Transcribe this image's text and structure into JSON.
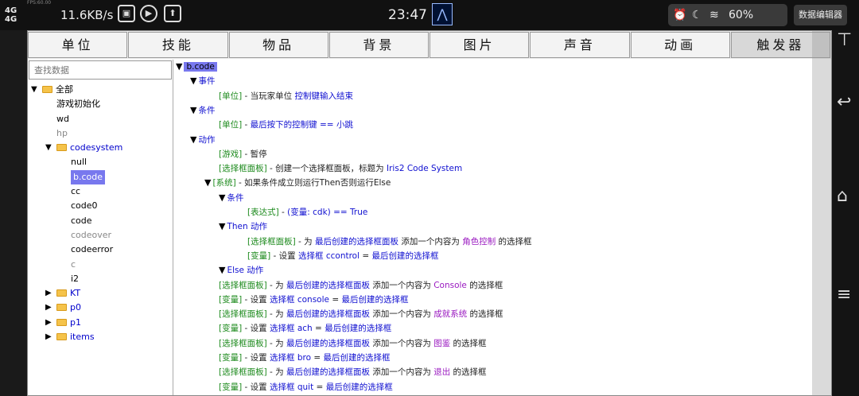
{
  "status_bar": {
    "signal": "4G",
    "tiny_label": "FPS:60.00",
    "speed": "11.6KB/s",
    "clock": "23:47",
    "battery": "60%",
    "mode_button": "数据编辑器"
  },
  "tabs": [
    "单位",
    "技能",
    "物品",
    "背景",
    "图片",
    "声音",
    "动画",
    "触发器"
  ],
  "search": {
    "placeholder": "查找数据"
  },
  "tree": [
    {
      "label": "全部",
      "indent": 0,
      "arrow": "▼",
      "folder": true,
      "style": ""
    },
    {
      "label": "游戏初始化",
      "indent": 1,
      "arrow": "",
      "folder": false,
      "style": ""
    },
    {
      "label": "wd",
      "indent": 1,
      "arrow": "",
      "folder": false,
      "style": ""
    },
    {
      "label": "hp",
      "indent": 1,
      "arrow": "",
      "folder": false,
      "style": "gray"
    },
    {
      "label": "codesystem",
      "indent": 1,
      "arrow": "▼",
      "folder": true,
      "style": "blue"
    },
    {
      "label": "null",
      "indent": 2,
      "arrow": "",
      "folder": false,
      "style": ""
    },
    {
      "label": "b.code",
      "indent": 2,
      "arrow": "",
      "folder": false,
      "style": "sel"
    },
    {
      "label": "cc",
      "indent": 2,
      "arrow": "",
      "folder": false,
      "style": ""
    },
    {
      "label": "code0",
      "indent": 2,
      "arrow": "",
      "folder": false,
      "style": ""
    },
    {
      "label": "code",
      "indent": 2,
      "arrow": "",
      "folder": false,
      "style": ""
    },
    {
      "label": "codeover",
      "indent": 2,
      "arrow": "",
      "folder": false,
      "style": "gray"
    },
    {
      "label": "codeerror",
      "indent": 2,
      "arrow": "",
      "folder": false,
      "style": ""
    },
    {
      "label": "c",
      "indent": 2,
      "arrow": "",
      "folder": false,
      "style": "gray"
    },
    {
      "label": "i2",
      "indent": 2,
      "arrow": "",
      "folder": false,
      "style": ""
    },
    {
      "label": "KT",
      "indent": 1,
      "arrow": "▶",
      "folder": true,
      "style": "blue"
    },
    {
      "label": "p0",
      "indent": 1,
      "arrow": "▶",
      "folder": true,
      "style": "blue"
    },
    {
      "label": "p1",
      "indent": 1,
      "arrow": "▶",
      "folder": true,
      "style": "blue"
    },
    {
      "label": "items",
      "indent": 1,
      "arrow": "▶",
      "folder": true,
      "style": "blue"
    }
  ],
  "code_lines": [
    {
      "indent": 0,
      "arrow": "▼",
      "parts": [
        {
          "t": "b.code",
          "c": "selhead"
        }
      ]
    },
    {
      "indent": 1,
      "arrow": "▼",
      "parts": [
        {
          "t": "事件",
          "c": "t-blue"
        }
      ]
    },
    {
      "indent": 2,
      "arrow": "",
      "parts": [
        {
          "t": "[单位]",
          "c": "t-green"
        },
        {
          "t": " - 当玩家单位 ",
          "c": "t-black"
        },
        {
          "t": "控制键输入结束",
          "c": "t-blue"
        }
      ]
    },
    {
      "indent": 1,
      "arrow": "▼",
      "parts": [
        {
          "t": "条件",
          "c": "t-blue"
        }
      ]
    },
    {
      "indent": 2,
      "arrow": "",
      "parts": [
        {
          "t": "[单位]",
          "c": "t-green"
        },
        {
          "t": " - ",
          "c": "t-black"
        },
        {
          "t": "最后按下的控制键 == 小跳",
          "c": "t-blue"
        }
      ]
    },
    {
      "indent": 1,
      "arrow": "▼",
      "parts": [
        {
          "t": "动作",
          "c": "t-blue"
        }
      ]
    },
    {
      "indent": 2,
      "arrow": "",
      "parts": [
        {
          "t": "[游戏]",
          "c": "t-green"
        },
        {
          "t": " - 暂停",
          "c": "t-black"
        }
      ]
    },
    {
      "indent": 2,
      "arrow": "",
      "parts": [
        {
          "t": "[选择框面板]",
          "c": "t-green"
        },
        {
          "t": " - 创建一个选择框面板，标题为 ",
          "c": "t-black"
        },
        {
          "t": "Iris2 Code System",
          "c": "t-blue"
        }
      ]
    },
    {
      "indent": 2,
      "arrow": "▼",
      "parts": [
        {
          "t": "[系统]",
          "c": "t-green"
        },
        {
          "t": " - 如果条件成立则运行Then否则运行Else",
          "c": "t-black"
        }
      ]
    },
    {
      "indent": 3,
      "arrow": "▼",
      "parts": [
        {
          "t": "条件",
          "c": "t-blue"
        }
      ]
    },
    {
      "indent": 4,
      "arrow": "",
      "parts": [
        {
          "t": "[表达式]",
          "c": "t-green"
        },
        {
          "t": " - ",
          "c": "t-black"
        },
        {
          "t": "(变量: cdk) == True",
          "c": "t-blue"
        }
      ]
    },
    {
      "indent": 3,
      "arrow": "▼",
      "parts": [
        {
          "t": "Then 动作",
          "c": "t-blue"
        }
      ]
    },
    {
      "indent": 4,
      "arrow": "",
      "parts": [
        {
          "t": "[选择框面板]",
          "c": "t-green"
        },
        {
          "t": " - 为 ",
          "c": "t-black"
        },
        {
          "t": "最后创建的选择框面板",
          "c": "t-blue"
        },
        {
          "t": " 添加一个内容为 ",
          "c": "t-black"
        },
        {
          "t": "角色控制",
          "c": "t-purple"
        },
        {
          "t": " 的选择框",
          "c": "t-black"
        }
      ]
    },
    {
      "indent": 4,
      "arrow": "",
      "parts": [
        {
          "t": "[变量]",
          "c": "t-green"
        },
        {
          "t": " - 设置 ",
          "c": "t-black"
        },
        {
          "t": "选择框 ccontrol",
          "c": "t-blue"
        },
        {
          "t": " = ",
          "c": "t-black"
        },
        {
          "t": "最后创建的选择框",
          "c": "t-blue"
        }
      ]
    },
    {
      "indent": 3,
      "arrow": "▼",
      "parts": [
        {
          "t": "Else 动作",
          "c": "t-blue"
        }
      ]
    },
    {
      "indent": 2,
      "arrow": "",
      "parts": [
        {
          "t": "[选择框面板]",
          "c": "t-green"
        },
        {
          "t": " - 为 ",
          "c": "t-black"
        },
        {
          "t": "最后创建的选择框面板",
          "c": "t-blue"
        },
        {
          "t": " 添加一个内容为 ",
          "c": "t-black"
        },
        {
          "t": "Console",
          "c": "t-purple"
        },
        {
          "t": " 的选择框",
          "c": "t-black"
        }
      ]
    },
    {
      "indent": 2,
      "arrow": "",
      "parts": [
        {
          "t": "[变量]",
          "c": "t-green"
        },
        {
          "t": " - 设置 ",
          "c": "t-black"
        },
        {
          "t": "选择框 console",
          "c": "t-blue"
        },
        {
          "t": " = ",
          "c": "t-black"
        },
        {
          "t": "最后创建的选择框",
          "c": "t-blue"
        }
      ]
    },
    {
      "indent": 2,
      "arrow": "",
      "parts": [
        {
          "t": "[选择框面板]",
          "c": "t-green"
        },
        {
          "t": " - 为 ",
          "c": "t-black"
        },
        {
          "t": "最后创建的选择框面板",
          "c": "t-blue"
        },
        {
          "t": " 添加一个内容为 ",
          "c": "t-black"
        },
        {
          "t": "成就系统",
          "c": "t-purple"
        },
        {
          "t": " 的选择框",
          "c": "t-black"
        }
      ]
    },
    {
      "indent": 2,
      "arrow": "",
      "parts": [
        {
          "t": "[变量]",
          "c": "t-green"
        },
        {
          "t": " - 设置 ",
          "c": "t-black"
        },
        {
          "t": "选择框 ach",
          "c": "t-blue"
        },
        {
          "t": " = ",
          "c": "t-black"
        },
        {
          "t": "最后创建的选择框",
          "c": "t-blue"
        }
      ]
    },
    {
      "indent": 2,
      "arrow": "",
      "parts": [
        {
          "t": "[选择框面板]",
          "c": "t-green"
        },
        {
          "t": " - 为 ",
          "c": "t-black"
        },
        {
          "t": "最后创建的选择框面板",
          "c": "t-blue"
        },
        {
          "t": " 添加一个内容为 ",
          "c": "t-black"
        },
        {
          "t": "图鉴",
          "c": "t-purple"
        },
        {
          "t": " 的选择框",
          "c": "t-black"
        }
      ]
    },
    {
      "indent": 2,
      "arrow": "",
      "parts": [
        {
          "t": "[变量]",
          "c": "t-green"
        },
        {
          "t": " - 设置 ",
          "c": "t-black"
        },
        {
          "t": "选择框 bro",
          "c": "t-blue"
        },
        {
          "t": " = ",
          "c": "t-black"
        },
        {
          "t": "最后创建的选择框",
          "c": "t-blue"
        }
      ]
    },
    {
      "indent": 2,
      "arrow": "",
      "parts": [
        {
          "t": "[选择框面板]",
          "c": "t-green"
        },
        {
          "t": " - 为 ",
          "c": "t-black"
        },
        {
          "t": "最后创建的选择框面板",
          "c": "t-blue"
        },
        {
          "t": " 添加一个内容为 ",
          "c": "t-black"
        },
        {
          "t": "退出",
          "c": "t-purple"
        },
        {
          "t": " 的选择框",
          "c": "t-black"
        }
      ]
    },
    {
      "indent": 2,
      "arrow": "",
      "parts": [
        {
          "t": "[变量]",
          "c": "t-green"
        },
        {
          "t": " - 设置 ",
          "c": "t-black"
        },
        {
          "t": "选择框 quit",
          "c": "t-blue"
        },
        {
          "t": " = ",
          "c": "t-black"
        },
        {
          "t": "最后创建的选择框",
          "c": "t-blue"
        }
      ]
    }
  ]
}
